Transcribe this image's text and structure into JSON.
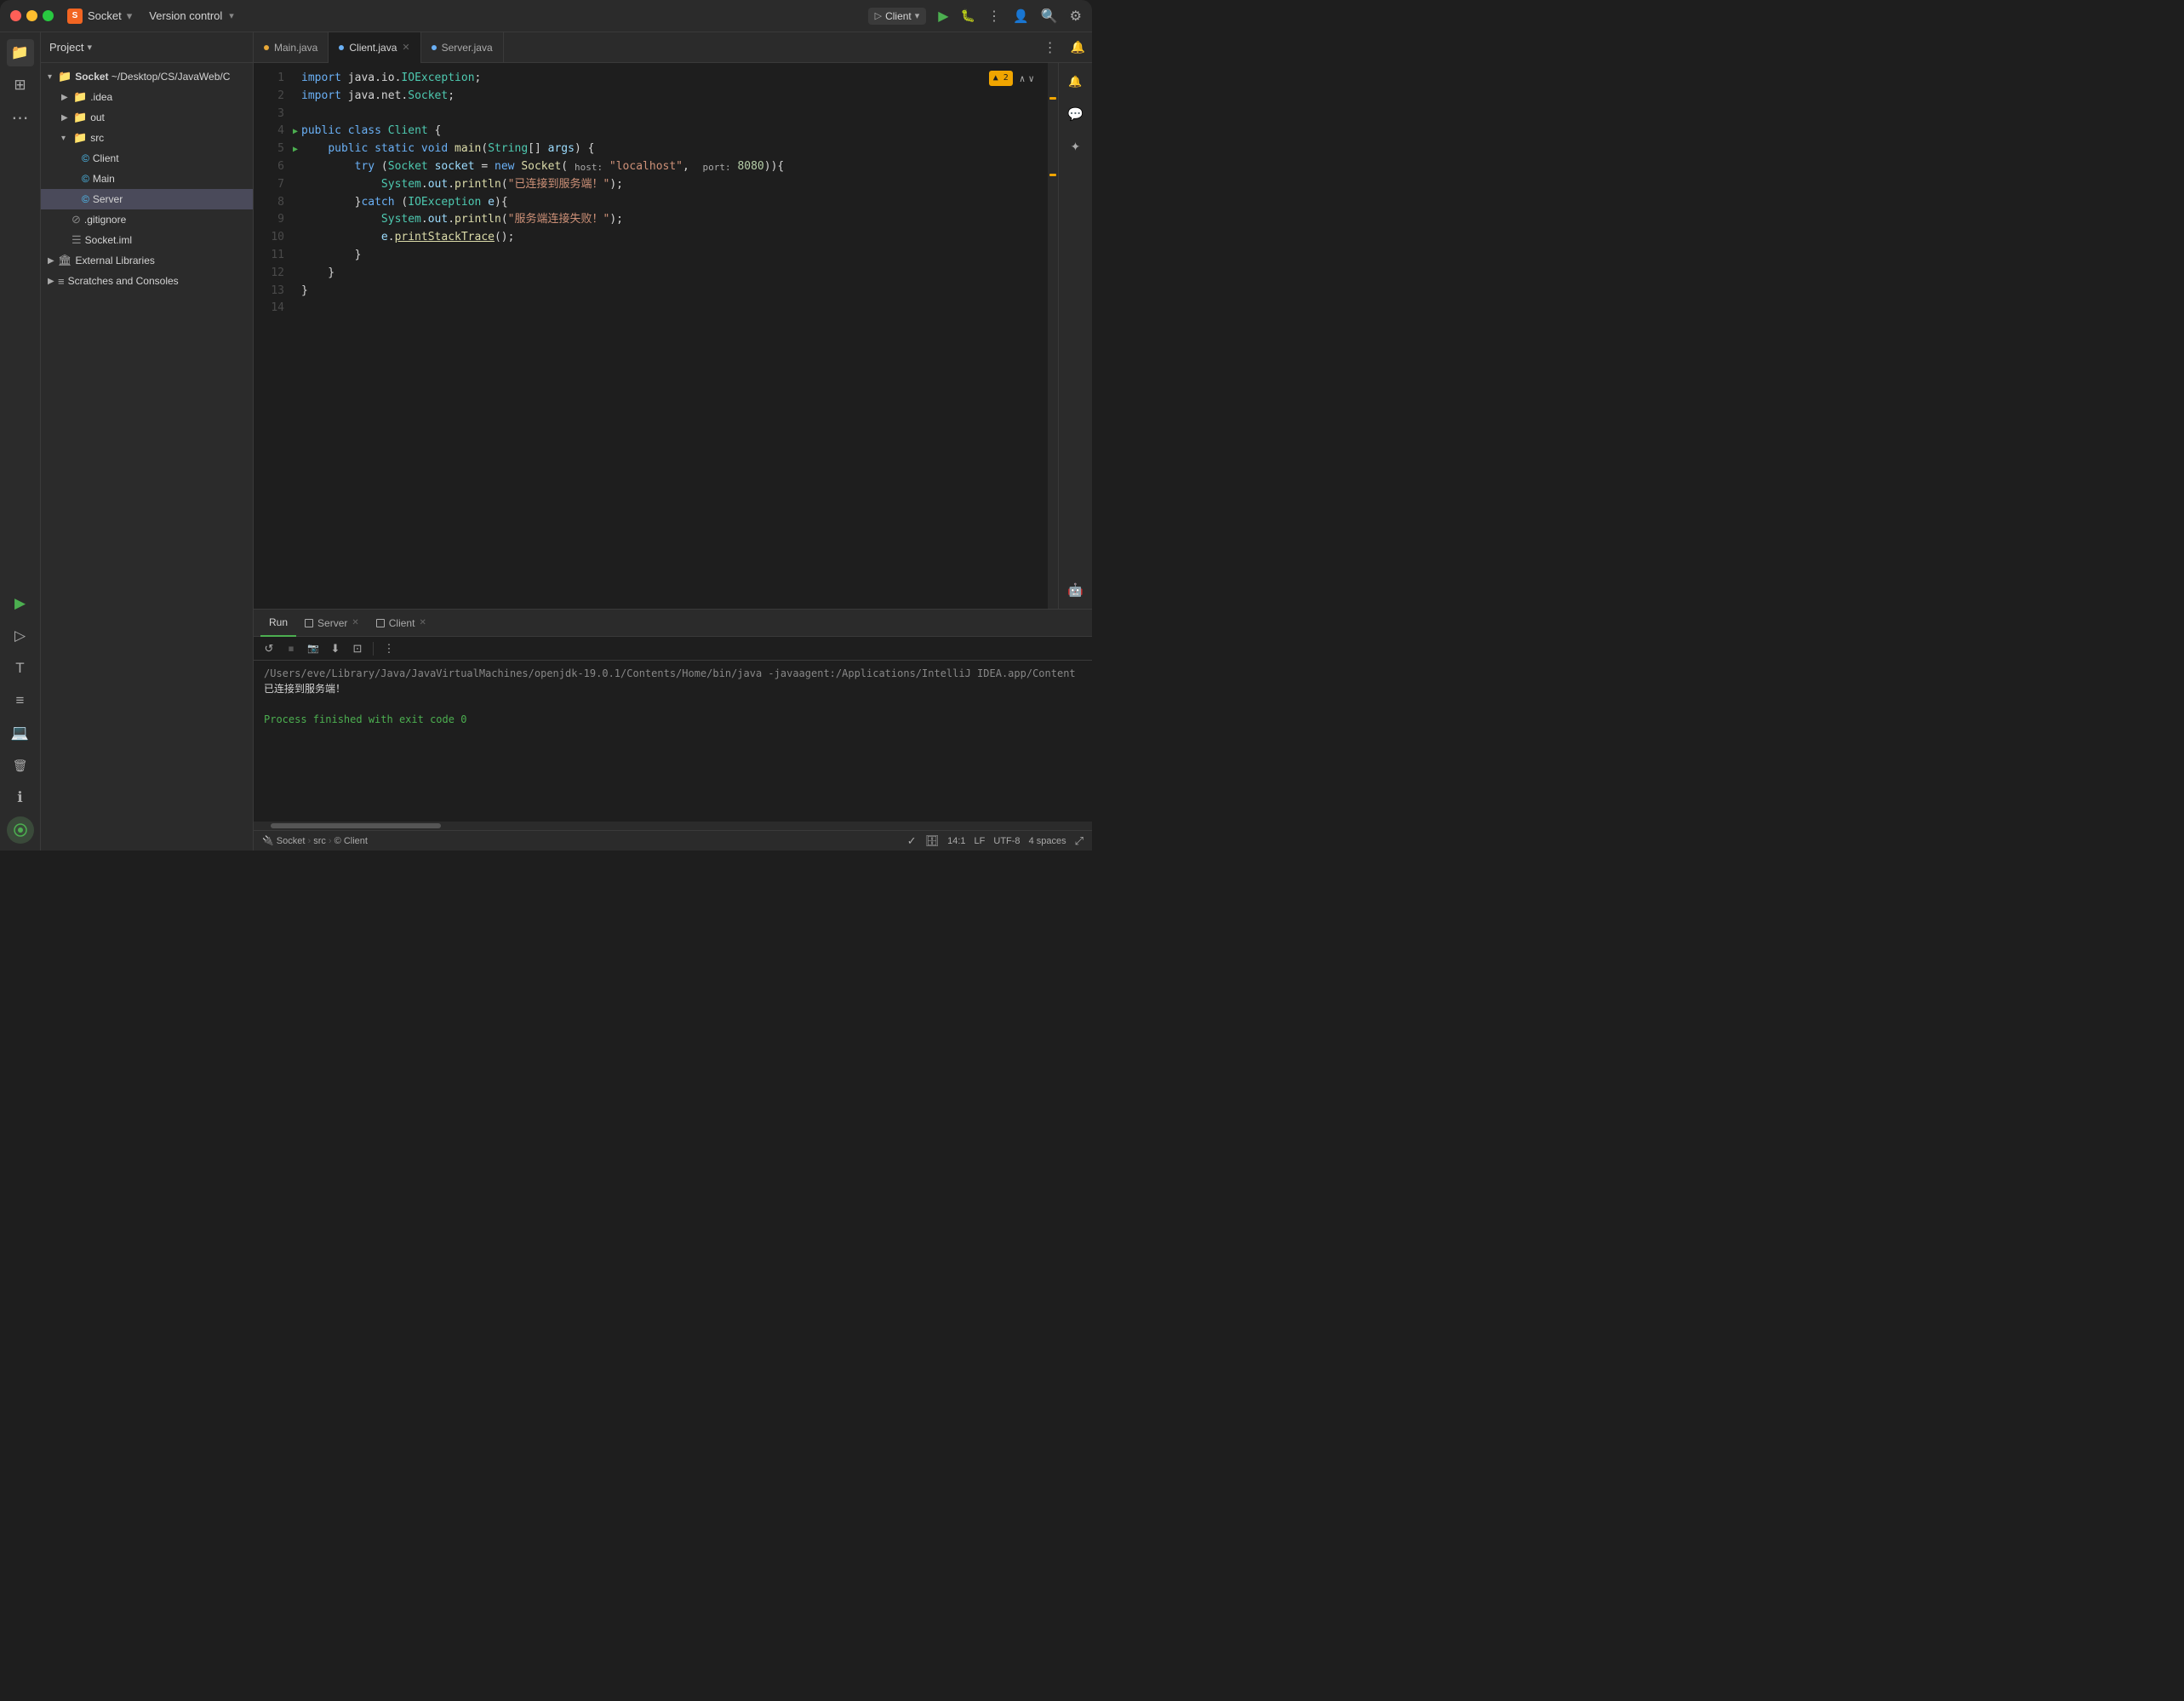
{
  "titlebar": {
    "app_name": "Socket",
    "app_icon": "S",
    "version_control": "Version control",
    "chevron": "▾",
    "run_config": "Client",
    "icons": {
      "notifications": "🔔",
      "debug": "🐛",
      "run": "▶",
      "build": "⚙",
      "more": "⋮",
      "account": "👤",
      "search": "🔍",
      "settings": "⚙"
    }
  },
  "sidebar": {
    "header": "Project",
    "tree": [
      {
        "id": "socket-root",
        "label": "Socket ~/Desktop/CS/JavaWeb/C",
        "depth": 0,
        "type": "folder",
        "expanded": true
      },
      {
        "id": "idea",
        "label": ".idea",
        "depth": 1,
        "type": "folder",
        "expanded": false
      },
      {
        "id": "out",
        "label": "out",
        "depth": 1,
        "type": "folder",
        "expanded": false
      },
      {
        "id": "src",
        "label": "src",
        "depth": 1,
        "type": "folder",
        "expanded": true
      },
      {
        "id": "client",
        "label": "Client",
        "depth": 2,
        "type": "java-c",
        "selected": false
      },
      {
        "id": "main",
        "label": "Main",
        "depth": 2,
        "type": "java-m"
      },
      {
        "id": "server",
        "label": "Server",
        "depth": 2,
        "type": "java-c",
        "selected": true
      },
      {
        "id": "gitignore",
        "label": ".gitignore",
        "depth": 1,
        "type": "git"
      },
      {
        "id": "socket-iml",
        "label": "Socket.iml",
        "depth": 1,
        "type": "iml"
      },
      {
        "id": "ext-libs",
        "label": "External Libraries",
        "depth": 0,
        "type": "ext-folder",
        "expanded": false
      },
      {
        "id": "scratches",
        "label": "Scratches and Consoles",
        "depth": 0,
        "type": "scratches",
        "expanded": false
      }
    ]
  },
  "tabs": [
    {
      "id": "main-java",
      "label": "Main.java",
      "active": false,
      "closable": false,
      "dot_color": "orange"
    },
    {
      "id": "client-java",
      "label": "Client.java",
      "active": true,
      "closable": true,
      "dot_color": "blue"
    },
    {
      "id": "server-java",
      "label": "Server.java",
      "active": false,
      "closable": false,
      "dot_color": "blue"
    }
  ],
  "code": {
    "warning_label": "▲ 2",
    "lines": [
      {
        "num": 1,
        "content": "import java.io.IOException;",
        "tokens": [
          {
            "t": "kw",
            "v": "import"
          },
          {
            "t": "text",
            "v": " java.io."
          },
          {
            "t": "type",
            "v": "IOException"
          },
          {
            "t": "text",
            "v": ";"
          }
        ]
      },
      {
        "num": 2,
        "content": "import java.net.Socket;",
        "tokens": [
          {
            "t": "kw",
            "v": "import"
          },
          {
            "t": "text",
            "v": " java.net."
          },
          {
            "t": "type",
            "v": "Socket"
          },
          {
            "t": "text",
            "v": ";"
          }
        ]
      },
      {
        "num": 3,
        "content": ""
      },
      {
        "num": 4,
        "content": "public class Client {",
        "tokens": [
          {
            "t": "kw",
            "v": "public"
          },
          {
            "t": "text",
            "v": " "
          },
          {
            "t": "kw",
            "v": "class"
          },
          {
            "t": "text",
            "v": " "
          },
          {
            "t": "type",
            "v": "Client"
          },
          {
            "t": "text",
            "v": " {"
          }
        ],
        "has_run": true
      },
      {
        "num": 5,
        "content": "    public static void main(String[] args) {",
        "tokens": [
          {
            "t": "text",
            "v": "    "
          },
          {
            "t": "kw",
            "v": "public"
          },
          {
            "t": "text",
            "v": " "
          },
          {
            "t": "kw",
            "v": "static"
          },
          {
            "t": "text",
            "v": " "
          },
          {
            "t": "kw",
            "v": "void"
          },
          {
            "t": "text",
            "v": " "
          },
          {
            "t": "fn",
            "v": "main"
          },
          {
            "t": "text",
            "v": "("
          },
          {
            "t": "type",
            "v": "String"
          },
          {
            "t": "text",
            "v": "[] "
          },
          {
            "t": "param",
            "v": "args"
          },
          {
            "t": "text",
            "v": ") {"
          }
        ],
        "has_run": true
      },
      {
        "num": 6,
        "content": "        try (Socket socket = new Socket( host: \"localhost\",  port: 8080)){",
        "tokens": [
          {
            "t": "text",
            "v": "        "
          },
          {
            "t": "kw",
            "v": "try"
          },
          {
            "t": "text",
            "v": " ("
          },
          {
            "t": "type",
            "v": "Socket"
          },
          {
            "t": "text",
            "v": " "
          },
          {
            "t": "param",
            "v": "socket"
          },
          {
            "t": "text",
            "v": " = "
          },
          {
            "t": "kw",
            "v": "new"
          },
          {
            "t": "text",
            "v": " "
          },
          {
            "t": "fn",
            "v": "Socket"
          },
          {
            "t": "text",
            "v": "( "
          },
          {
            "t": "annotation",
            "v": "host:"
          },
          {
            "t": "text",
            "v": " "
          },
          {
            "t": "str",
            "v": "\"localhost\""
          },
          {
            "t": "text",
            "v": ",  "
          },
          {
            "t": "annotation",
            "v": "port:"
          },
          {
            "t": "text",
            "v": " "
          },
          {
            "t": "num",
            "v": "8080"
          },
          {
            "t": "text",
            "v": ")){"
          }
        ]
      },
      {
        "num": 7,
        "content": "            System.out.println(\"已连接到服务端！\");",
        "tokens": [
          {
            "t": "text",
            "v": "            "
          },
          {
            "t": "type",
            "v": "System"
          },
          {
            "t": "text",
            "v": "."
          },
          {
            "t": "fn",
            "v": "out"
          },
          {
            "t": "text",
            "v": "."
          },
          {
            "t": "fn",
            "v": "println"
          },
          {
            "t": "text",
            "v": "("
          },
          {
            "t": "str",
            "v": "\"已连接到服务端！\""
          },
          {
            "t": "text",
            "v": ");"
          }
        ]
      },
      {
        "num": 8,
        "content": "        }catch (IOException e){",
        "tokens": [
          {
            "t": "text",
            "v": "        }"
          },
          {
            "t": "kw",
            "v": "catch"
          },
          {
            "t": "text",
            "v": " ("
          },
          {
            "t": "type",
            "v": "IOException"
          },
          {
            "t": "text",
            "v": " "
          },
          {
            "t": "param",
            "v": "e"
          },
          {
            "t": "text",
            "v": "}{"
          }
        ]
      },
      {
        "num": 9,
        "content": "            System.out.println(\"服务端连接失败！\");",
        "tokens": [
          {
            "t": "text",
            "v": "            "
          },
          {
            "t": "type",
            "v": "System"
          },
          {
            "t": "text",
            "v": "."
          },
          {
            "t": "fn",
            "v": "out"
          },
          {
            "t": "text",
            "v": "."
          },
          {
            "t": "fn",
            "v": "println"
          },
          {
            "t": "text",
            "v": "("
          },
          {
            "t": "str",
            "v": "\"服务端连接失败！\""
          },
          {
            "t": "text",
            "v": ");"
          }
        ]
      },
      {
        "num": 10,
        "content": "            e.printStackTrace();",
        "tokens": [
          {
            "t": "text",
            "v": "            "
          },
          {
            "t": "param",
            "v": "e"
          },
          {
            "t": "text",
            "v": "."
          },
          {
            "t": "fn",
            "v": "printStackTrace"
          },
          {
            "t": "text",
            "v": "();"
          }
        ]
      },
      {
        "num": 11,
        "content": "        }",
        "tokens": [
          {
            "t": "text",
            "v": "        }"
          }
        ]
      },
      {
        "num": 12,
        "content": "    }",
        "tokens": [
          {
            "t": "text",
            "v": "    }"
          }
        ]
      },
      {
        "num": 13,
        "content": "}",
        "tokens": [
          {
            "t": "text",
            "v": "}"
          }
        ]
      },
      {
        "num": 14,
        "content": ""
      }
    ]
  },
  "bottom_panel": {
    "tabs": [
      {
        "id": "run",
        "label": "Run",
        "active": true
      },
      {
        "id": "server-tab",
        "label": "Server",
        "active": false,
        "closable": true
      },
      {
        "id": "client-tab",
        "label": "Client",
        "active": false,
        "closable": true
      }
    ],
    "console_lines": [
      {
        "id": "cmd",
        "text": "/Users/eve/Library/Java/JavaVirtualMachines/openjdk-19.0.1/Contents/Home/bin/java -javaagent:/Applications/IntelliJ IDEA.app/Content",
        "type": "gray"
      },
      {
        "id": "connected",
        "text": "已连接到服务端！",
        "type": "normal"
      },
      {
        "id": "blank",
        "text": "",
        "type": "normal"
      },
      {
        "id": "exit",
        "text": "Process finished with exit code 0",
        "type": "green"
      }
    ]
  },
  "statusbar": {
    "breadcrumb": "Socket > src > Client",
    "position": "14:1",
    "line_sep": "LF",
    "encoding": "UTF-8",
    "indent": "4 spaces",
    "icon_check": "✓",
    "icon_db": "🗄"
  },
  "right_icons": [
    "🤖",
    "✨",
    "—",
    "🤖"
  ],
  "left_icons": [
    "📁",
    "⊞",
    "⋮",
    "▶",
    "▶",
    "T",
    "≡",
    "💻",
    "🗑",
    "ℹ",
    "⚙"
  ]
}
